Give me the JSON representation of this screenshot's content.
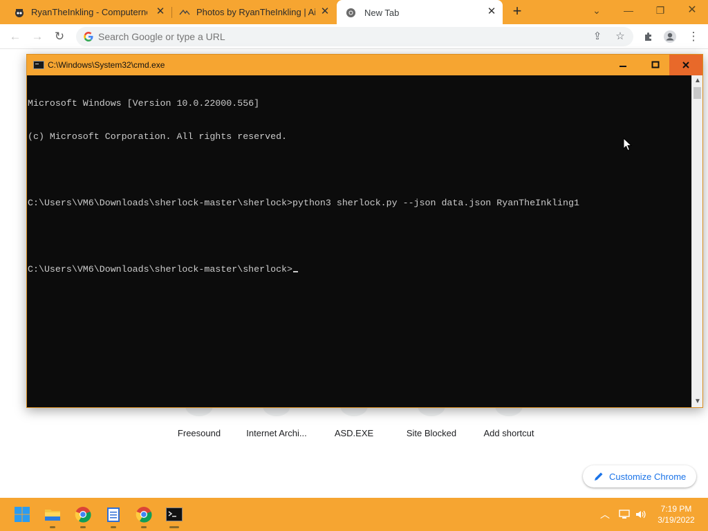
{
  "browser": {
    "tabs": [
      {
        "title": "RyanTheInkling - Computernewb",
        "icon": "spy-favicon-icon"
      },
      {
        "title": "Photos by RyanTheInkling | Airli",
        "icon": "airliners-favicon-icon"
      },
      {
        "title": "New Tab",
        "icon": "chrome-favicon-icon"
      }
    ],
    "new_tab_symbol": "+",
    "omnibox": {
      "placeholder": "Search Google or type a URL"
    },
    "shortcuts": [
      {
        "label": "Freesound"
      },
      {
        "label": "Internet Archi..."
      },
      {
        "label": "ASD.EXE"
      },
      {
        "label": "Site Blocked"
      },
      {
        "label": "Add shortcut"
      }
    ],
    "customize_label": "Customize Chrome"
  },
  "cmd": {
    "title": "C:\\Windows\\System32\\cmd.exe",
    "lines": [
      "Microsoft Windows [Version 10.0.22000.556]",
      "(c) Microsoft Corporation. All rights reserved.",
      "",
      "C:\\Users\\VM6\\Downloads\\sherlock-master\\sherlock>python3 sherlock.py --json data.json RyanTheInkling1",
      "",
      "C:\\Users\\VM6\\Downloads\\sherlock-master\\sherlock>"
    ]
  },
  "taskbar": {
    "apps": [
      "windows-start-icon",
      "file-explorer-icon",
      "chrome-icon",
      "notepad-icon",
      "chrome-icon",
      "cmd-icon"
    ],
    "time": "7:19 PM",
    "date": "3/19/2022"
  },
  "colors": {
    "accent": "#f6a531",
    "console_bg": "#0c0c0c",
    "console_fg": "#cccccc",
    "close_button": "#e8692a",
    "link_blue": "#1a73e8"
  }
}
